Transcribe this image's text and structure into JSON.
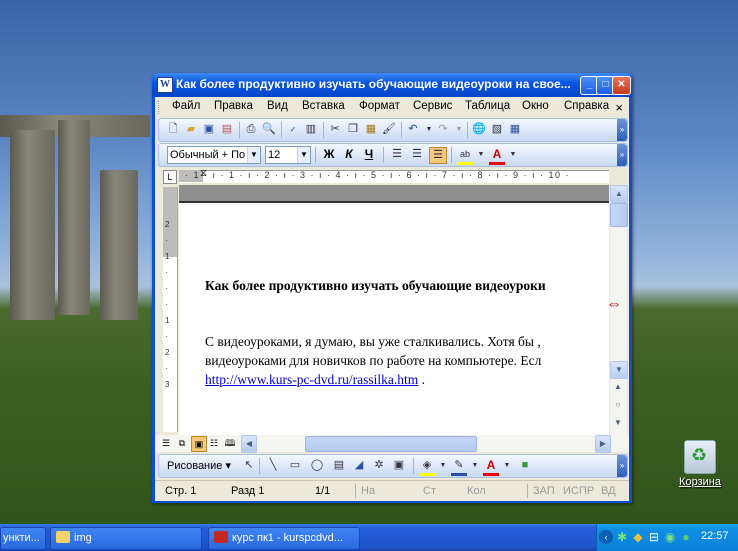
{
  "window": {
    "title": "Как более продуктивно изучать обучающие видеоуроки на свое...",
    "app_icon": "W",
    "controls": {
      "minimize": "_",
      "maximize": "□",
      "close": "✕"
    }
  },
  "menu": {
    "items": [
      "Файл",
      "Правка",
      "Вид",
      "Вставка",
      "Формат",
      "Сервис",
      "Таблица",
      "Окно",
      "Справка"
    ],
    "close": "×"
  },
  "standard_toolbar": {
    "icons": [
      "new-doc-icon",
      "open-icon",
      "save-icon",
      "permission-icon",
      "print-icon",
      "print-preview-icon",
      "spelling-icon",
      "research-icon",
      "cut-icon",
      "copy-icon",
      "paste-icon",
      "format-painter-icon",
      "undo-icon",
      "redo-icon",
      "hyperlink-icon",
      "tables-borders-icon",
      "insert-table-icon"
    ]
  },
  "formatting_toolbar": {
    "style": "Обычный + По ц",
    "font_size": "12",
    "bold": "Ж",
    "italic": "К",
    "underline": "Ч",
    "highlight_label": "ab",
    "font_color_label": "A"
  },
  "ruler": {
    "tab_selector": "L",
    "numbers": "· 1 · ı · 1 · ı · 2 · ı · 3 · ı · 4 · ı · 5 · ı · 6 · ı · 7 · ı · 8 · ı · 9 · ı · 10 ·"
  },
  "vertical_ruler": {
    "marks": [
      "2",
      "·",
      "1",
      "·",
      "·",
      "·",
      "1",
      "·",
      "2",
      "·",
      "3"
    ]
  },
  "document": {
    "heading": "Как более продуктивно изучать обучающие видеоуроки",
    "para_line1": "С видеоуроками, я думаю, вы уже сталкивались. Хотя бы ,",
    "para_line2": "видеоуроками для новичков по работе на компьютере. Есл",
    "link": "http://www.kurs-pc-dvd.ru/rassilka.htm",
    "link_suffix": " ."
  },
  "drawing_toolbar": {
    "label": "Рисование ▾",
    "icons": [
      "select-arrow-icon",
      "line-icon",
      "rectangle-icon",
      "oval-icon",
      "textbox-icon",
      "wordart-icon",
      "diagram-icon",
      "clipart-icon",
      "fill-color-icon",
      "line-color-icon",
      "font-color-icon",
      "shadow-icon"
    ]
  },
  "status": {
    "page": "Стр. 1",
    "section": "Разд 1",
    "pages": "1/1",
    "at": "На",
    "line": "Ст",
    "col": "Кол",
    "rec": "ЗАП",
    "trk": "ИСПР",
    "ext": "ВД"
  },
  "desktop": {
    "recycle_bin": "Корзина"
  },
  "taskbar": {
    "task1": "ункти...",
    "task2": "img",
    "task3": "курс пк1 - kurspcdvd...",
    "clock": "22:57"
  },
  "colors": {
    "titlebar": "#0a55e0",
    "taskbar": "#245edb",
    "tray": "#0f8ee3",
    "link": "#0000cc"
  }
}
